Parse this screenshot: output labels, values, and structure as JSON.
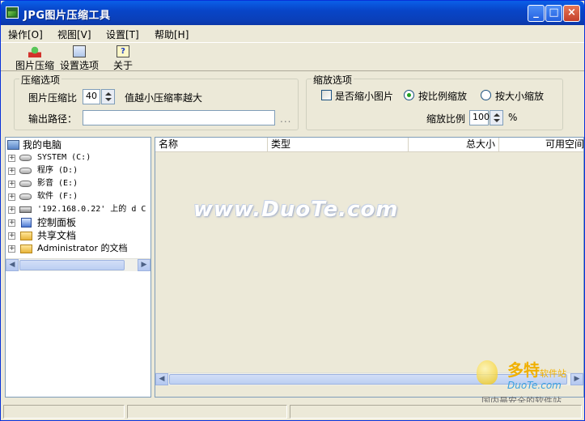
{
  "window": {
    "title": "JPG图片压缩工具",
    "controls": {
      "minimize": "_",
      "maximize": "□",
      "close": "×"
    }
  },
  "menu": [
    {
      "label": "操作[O]"
    },
    {
      "label": "视图[V]"
    },
    {
      "label": "设置[T]"
    },
    {
      "label": "帮助[H]"
    }
  ],
  "toolbar": [
    {
      "label": "图片压缩",
      "icon": "compress-icon"
    },
    {
      "label": "设置选项",
      "icon": "settings-icon"
    },
    {
      "label": "关于",
      "icon": "about-icon"
    }
  ],
  "compress_options": {
    "title": "压缩选项",
    "ratio_label": "图片压缩比",
    "ratio_value": "40",
    "ratio_hint": "值越小压缩率越大",
    "output_label": "输出路径：",
    "output_value": "",
    "browse_label": "..."
  },
  "scale_options": {
    "title": "缩放选项",
    "shrink_label": "是否缩小图片",
    "shrink_checked": false,
    "by_ratio_label": "按比例缩放",
    "by_ratio_selected": true,
    "by_size_label": "按大小缩放",
    "by_size_selected": false,
    "scale_label": "缩放比例",
    "scale_value": "100",
    "scale_unit": "%"
  },
  "tree": {
    "root": "我的电脑",
    "items": [
      {
        "label": "SYSTEM (C:)",
        "icon": "drive-icon"
      },
      {
        "label": "程序 (D:)",
        "icon": "drive-icon"
      },
      {
        "label": "影音 (E:)",
        "icon": "drive-icon"
      },
      {
        "label": "软件 (F:)",
        "icon": "drive-icon"
      },
      {
        "label": "'192.168.0.22' 上的 d C",
        "icon": "network-drive-icon"
      },
      {
        "label": "控制面板",
        "icon": "control-panel-icon"
      },
      {
        "label": "共享文档",
        "icon": "folder-icon"
      },
      {
        "label": "Administrator 的文档",
        "icon": "folder-icon"
      }
    ]
  },
  "list": {
    "columns": [
      {
        "label": "名称"
      },
      {
        "label": "类型"
      },
      {
        "label": "总大小"
      },
      {
        "label": "可用空间"
      }
    ]
  },
  "watermark": {
    "center": "www.DuoTe.com",
    "logo_big": "多特",
    "logo_small": "软件站",
    "logo_url": "DuoTe.com",
    "logo_tag": "国内最安全的软件站"
  },
  "colors": {
    "titlebar": "#0845c8",
    "window_bg": "#ece9d8",
    "border": "#7f9db9",
    "radio_dot": "#21a121"
  }
}
